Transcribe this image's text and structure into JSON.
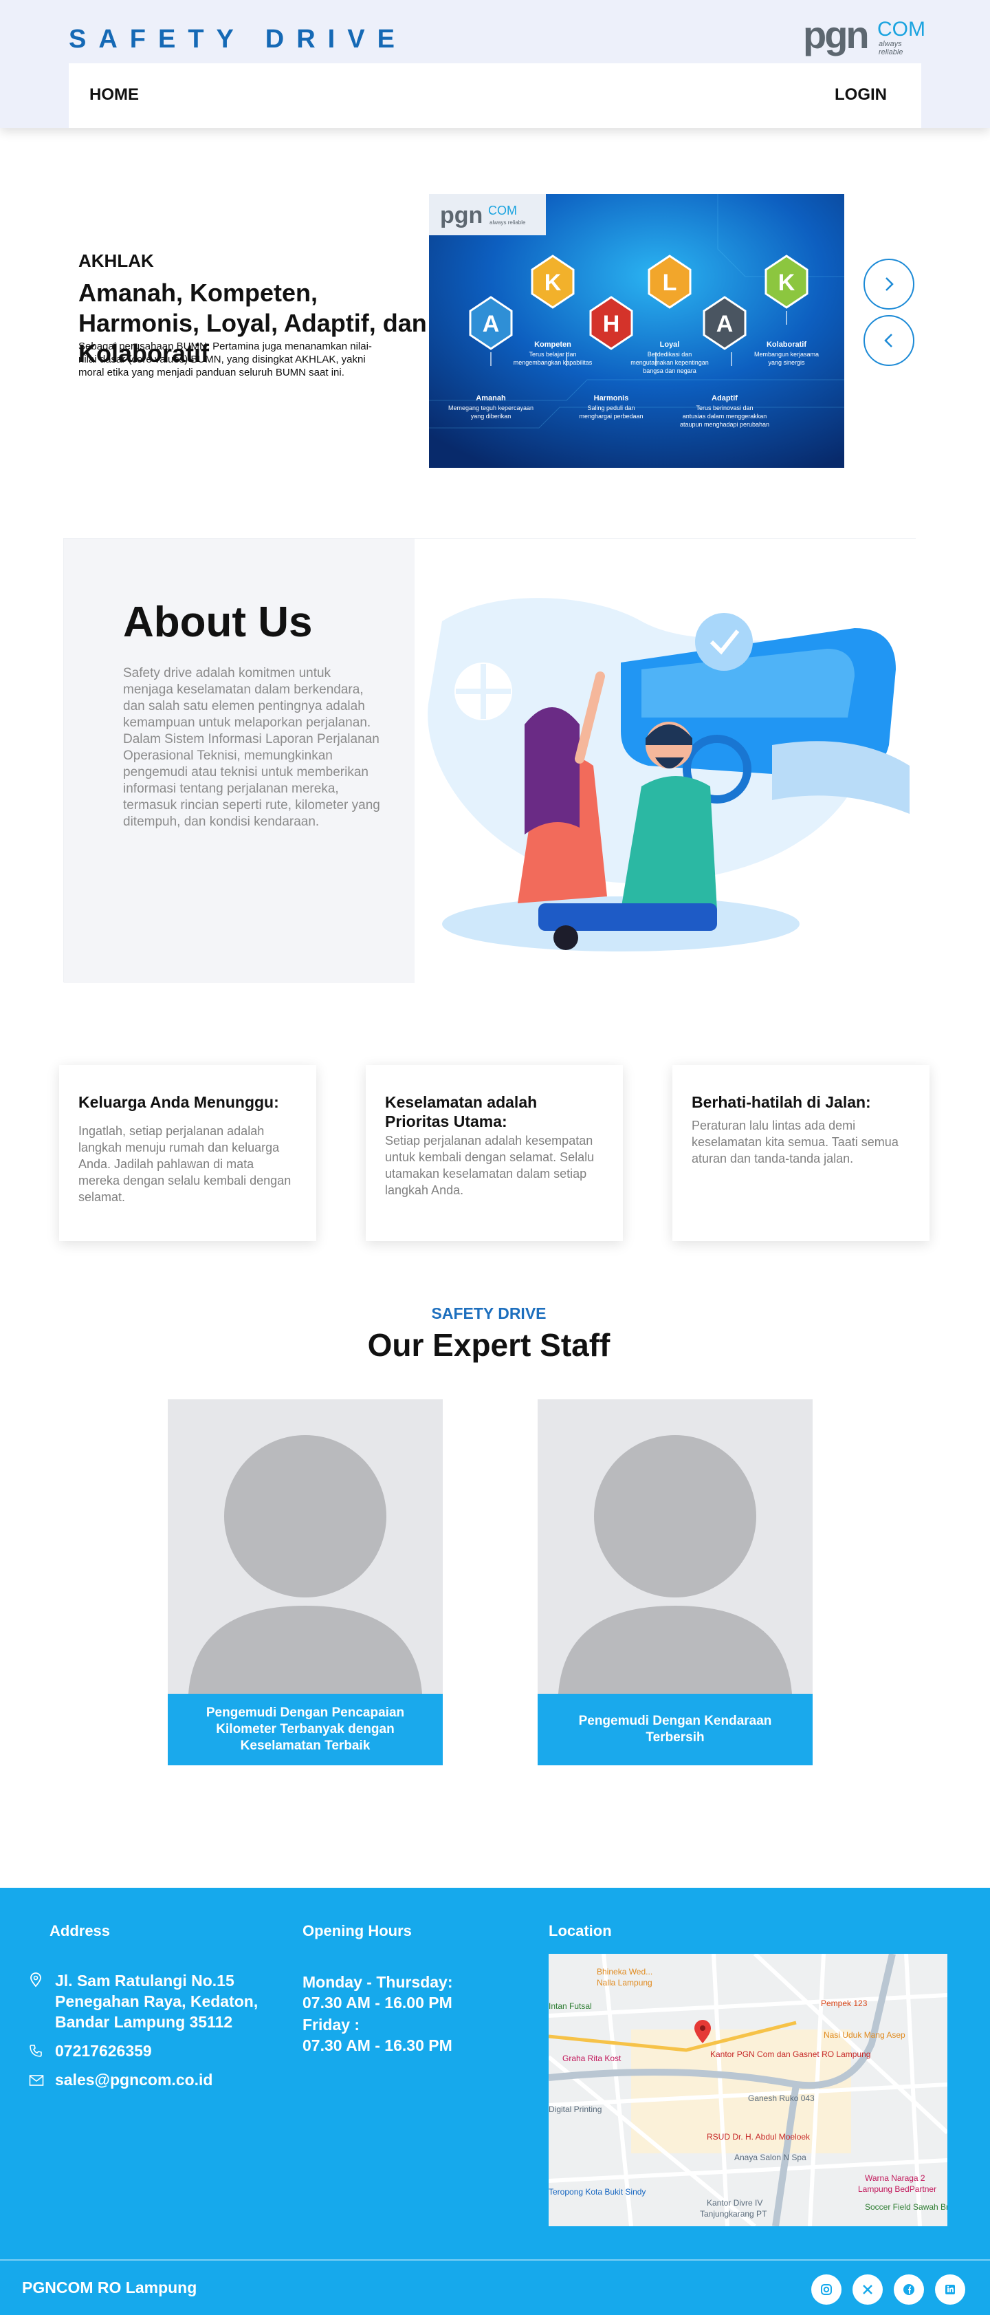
{
  "header": {
    "brand": "SAFETY DRIVE",
    "logo": {
      "pgn": "pgn",
      "com": "COM",
      "tagline": "always reliable"
    },
    "nav": {
      "home": "HOME",
      "login": "LOGIN"
    }
  },
  "hero": {
    "subtitle": "AKHLAK",
    "title": "Amanah, Kompeten, Harmonis, Loyal, Adaptif, dan Kolaboratif",
    "description": "Sebagai perusahaan BUMN, Pertamina juga menanamkan nilai-nilai dasar (core values) BUMN, yang disingkat AKHLAK, yakni moral etika yang menjadi panduan seluruh BUMN saat ini.",
    "banner": {
      "logo_pgn": "pgn",
      "logo_com": "COM",
      "logo_tag": "always reliable",
      "letters": [
        "A",
        "K",
        "H",
        "L",
        "A",
        "K"
      ],
      "values": [
        {
          "name": "Amanah",
          "desc1": "Memegang teguh kepercayaan",
          "desc2": "yang diberikan"
        },
        {
          "name": "Kompeten",
          "desc1": "Terus belajar dan",
          "desc2": "mengembangkan kapabilitas"
        },
        {
          "name": "Harmonis",
          "desc1": "Saling peduli dan",
          "desc2": "menghargai perbedaan"
        },
        {
          "name": "Loyal",
          "desc1": "Berdedikasi dan",
          "desc2": "mengutamakan kepentingan",
          "desc3": "bangsa dan negara"
        },
        {
          "name": "Adaptif",
          "desc1": "Terus berinovasi dan",
          "desc2": "antusias dalam menggerakkan",
          "desc3": "ataupun menghadapi perubahan"
        },
        {
          "name": "Kolaboratif",
          "desc1": "Membangun kerjasama",
          "desc2": "yang sinergis"
        }
      ]
    },
    "next_icon": "chevron-right-icon",
    "prev_icon": "chevron-left-icon"
  },
  "about": {
    "title": "About Us",
    "text": "Safety drive adalah komitmen untuk menjaga keselamatan dalam berkendara, dan salah satu elemen pentingnya adalah kemampuan untuk melaporkan perjalanan. Dalam Sistem Informasi Laporan Perjalanan Operasional Teknisi, memungkinkan pengemudi atau teknisi untuk memberikan informasi tentang perjalanan mereka, termasuk rincian seperti rute, kilometer yang ditempuh, dan kondisi kendaraan."
  },
  "cards": [
    {
      "title": "Keluarga Anda Menunggu:",
      "text": "Ingatlah, setiap perjalanan adalah langkah menuju rumah dan keluarga Anda. Jadilah pahlawan di mata mereka dengan selalu kembali dengan selamat."
    },
    {
      "title": "Keselamatan adalah Prioritas Utama:",
      "text": "Setiap perjalanan adalah kesempatan untuk kembali dengan selamat. Selalu utamakan keselamatan dalam setiap langkah Anda."
    },
    {
      "title": "Berhati-hatilah di Jalan:",
      "text": "Peraturan lalu lintas ada demi keselamatan kita semua. Taati semua aturan dan tanda-tanda jalan."
    }
  ],
  "staff": {
    "kicker": "SAFETY DRIVE",
    "title": "Our Expert Staff",
    "members": [
      {
        "caption": "Pengemudi Dengan Pencapaian Kilometer Terbanyak dengan Keselamatan Terbaik"
      },
      {
        "caption": "Pengemudi Dengan Kendaraan Terbersih"
      }
    ]
  },
  "footer": {
    "address_heading": "Address",
    "address": "Jl. Sam Ratulangi No.15 Penegahan Raya, Kedaton, Bandar Lampung 35112",
    "phone": "07217626359",
    "email": "sales@pgncom.co.id",
    "hours_heading": "Opening Hours",
    "weekday_label": "Monday - Thursday:",
    "weekday_hours": "07.30 AM - 16.00 PM",
    "friday_label": "Friday :",
    "friday_hours": "07.30 AM - 16.30 PM",
    "location_heading": "Location",
    "map_labels": {
      "bhw": "Bhineka Wed...",
      "nalla": "Nalla Lampung",
      "futsal": "Intan Futsal",
      "pempek": "Pempek 123",
      "nasi": "Nasi Uduk Mang Asep",
      "graha": "Graha Rita Kost",
      "kantor": "Kantor PGN Com dan Gasnet RO Lampung",
      "ganesh": "Ganesh Ruko 043",
      "digital": "Digital Printing",
      "rsud": "RSUD Dr. H. Abdul Moeloek",
      "anaya": "Anaya Salon N Spa",
      "warna": "Warna Naraga 2",
      "lampung_bp": "Lampung BedPartner",
      "kopi": "Teropong Kota Bukit Sindy",
      "kantor_dv": "Kantor Divre IV",
      "tanjung": "Tanjungkarang PT",
      "soccer": "Soccer Field Sawah Brebes"
    },
    "bottom_name": "PGNCOM RO Lampung",
    "socials": [
      "instagram-icon",
      "x-icon",
      "facebook-icon",
      "linkedin-icon"
    ]
  },
  "colors": {
    "brand_blue": "#1569b5",
    "accent": "#16a9ec",
    "header_bg": "#edf0fa"
  }
}
